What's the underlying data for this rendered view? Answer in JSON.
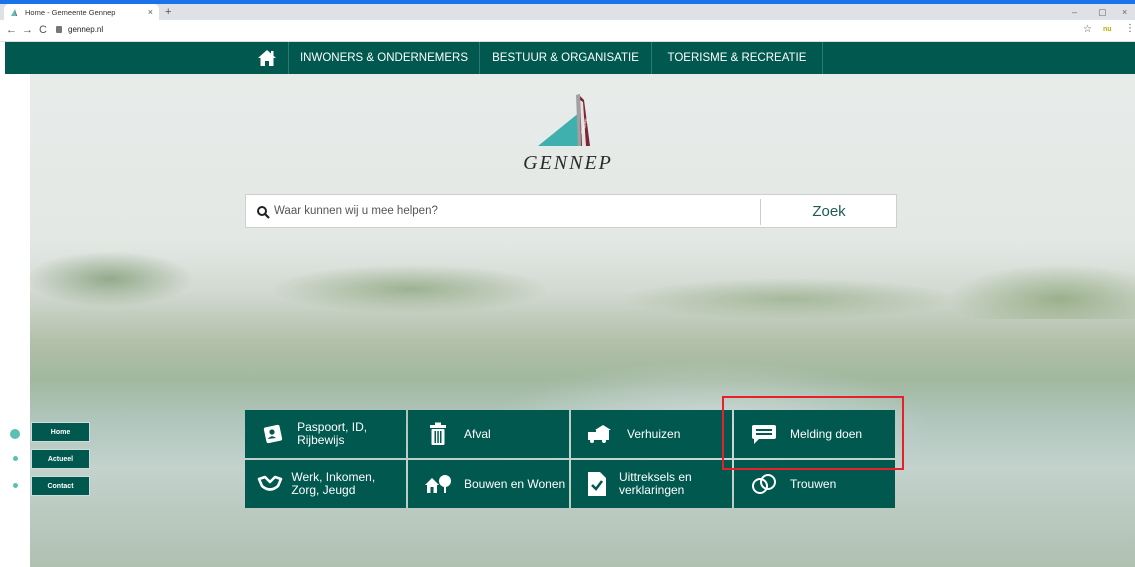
{
  "browser": {
    "tab_title": "Home - Gemeente Gennep",
    "tab_close": "×",
    "new_tab": "+",
    "url": "gennep.nl",
    "back": "←",
    "forward": "→",
    "reload": "C",
    "star": "☆",
    "extension": "nu",
    "menu": "⋮",
    "minimize": "–",
    "maximize": "▢",
    "close": "×"
  },
  "nav": {
    "items": [
      {
        "label": "INWONERS & ONDERNEMERS"
      },
      {
        "label": "BESTUUR & ORGANISATIE"
      },
      {
        "label": "TOERISME & RECREATIE"
      }
    ]
  },
  "logo": {
    "text": "GENNEP",
    "vertical_text": "Gennep"
  },
  "search": {
    "placeholder": "Waar kunnen wij u mee helpen?",
    "button": "Zoek"
  },
  "tiles": [
    {
      "label": "Paspoort, ID, Rijbewijs",
      "icon": "id-card-icon"
    },
    {
      "label": "Afval",
      "icon": "trash-icon"
    },
    {
      "label": "Verhuizen",
      "icon": "moving-truck-icon"
    },
    {
      "label": "Melding doen",
      "icon": "message-icon"
    },
    {
      "label": "Werk, Inkomen, Zorg, Jeugd",
      "icon": "hands-icon"
    },
    {
      "label": "Bouwen en Wonen",
      "icon": "house-tree-icon"
    },
    {
      "label": "Uittreksels en verklaringen",
      "icon": "document-check-icon"
    },
    {
      "label": "Trouwen",
      "icon": "rings-icon"
    }
  ],
  "sidenav": {
    "items": [
      {
        "label": "Home"
      },
      {
        "label": "Actueel"
      },
      {
        "label": "Contact"
      }
    ]
  },
  "colors": {
    "brand": "#00584f",
    "accent": "#5bbfb2",
    "highlight": "#e8202a"
  }
}
